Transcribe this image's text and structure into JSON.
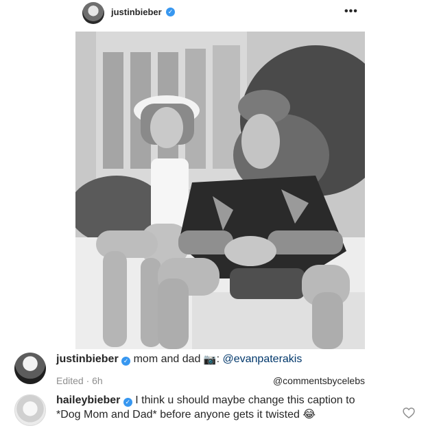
{
  "post": {
    "username": "justinbieber",
    "verified": true,
    "more_icon": "more-horizontal-icon",
    "more_label": "•••"
  },
  "caption": {
    "username": "justinbieber",
    "text": "mom and dad",
    "camera_icon": "📷",
    "separator": ":",
    "mention": "@evanpaterakis",
    "meta": "Edited · 6h",
    "credit": "@commentsbycelebs"
  },
  "comment": {
    "username": "haileybieber",
    "verified": true,
    "text": "I think u should maybe change this caption to *Dog Mom and Dad* before anyone gets it twisted",
    "emoji": "😂",
    "like_icon": "heart-outline-icon"
  },
  "colors": {
    "verified": "#3797f0",
    "text": "#262626",
    "meta": "#8e8e8e",
    "mention": "#00376b"
  }
}
